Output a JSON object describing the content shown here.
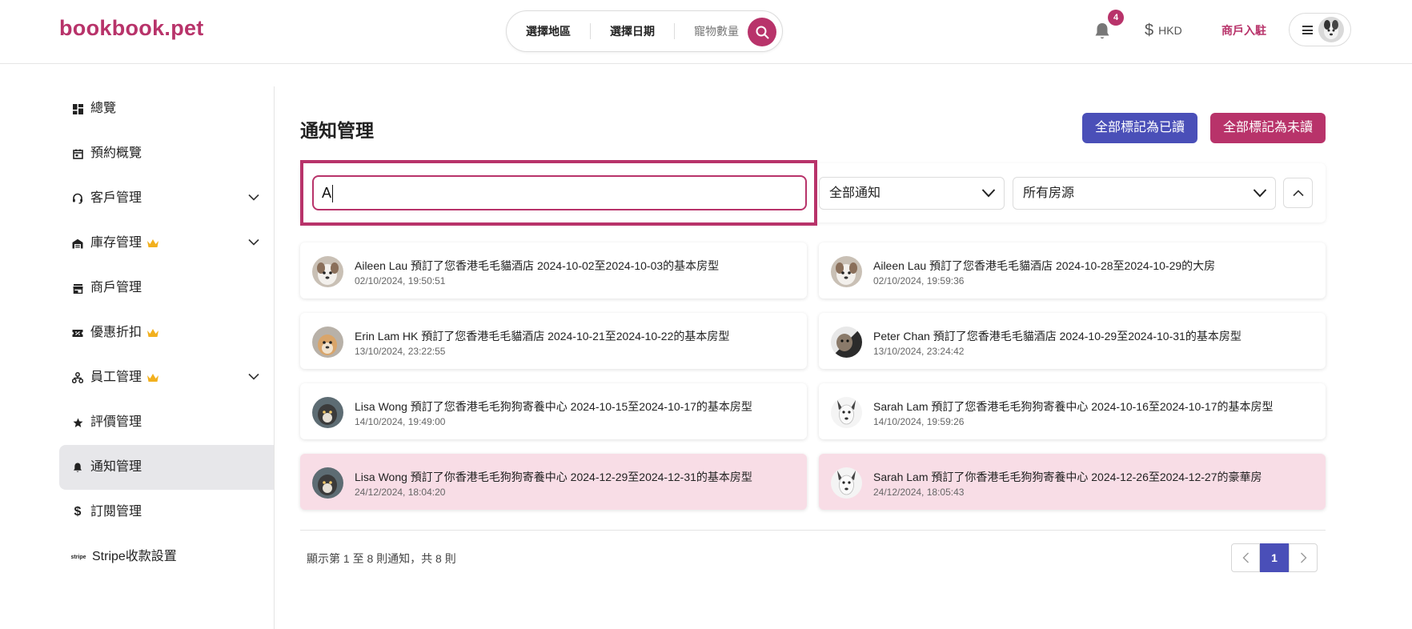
{
  "brand": {
    "logo_text": "bookbook.pet",
    "accent": "#b8336a",
    "secondary": "#4a4fb8"
  },
  "header": {
    "search": {
      "region": "選擇地區",
      "date": "選擇日期",
      "pets": "寵物數量"
    },
    "notification_count": "4",
    "currency": "HKD",
    "merchant_link": "商戶入駐"
  },
  "sidebar": {
    "items": [
      {
        "label": "總覽",
        "icon": "dashboard-icon"
      },
      {
        "label": "預約概覽",
        "icon": "calendar-icon"
      },
      {
        "label": "客戶管理",
        "icon": "headset-icon",
        "expandable": true
      },
      {
        "label": "庫存管理",
        "icon": "warehouse-icon",
        "premium": true,
        "expandable": true
      },
      {
        "label": "商戶管理",
        "icon": "store-icon"
      },
      {
        "label": "優惠折扣",
        "icon": "ticket-icon",
        "premium": true
      },
      {
        "label": "員工管理",
        "icon": "org-chart-icon",
        "premium": true,
        "expandable": true
      },
      {
        "label": "評價管理",
        "icon": "star-icon"
      },
      {
        "label": "通知管理",
        "icon": "bell-icon",
        "active": true
      },
      {
        "label": "訂閱管理",
        "icon": "dollar-icon"
      },
      {
        "label": "Stripe收款設置",
        "icon": "stripe-icon"
      }
    ]
  },
  "main": {
    "title": "通知管理",
    "mark_all_read": "全部標記為已讀",
    "mark_all_unread": "全部標記為未讀",
    "search_value": "A",
    "filter_type": "全部通知",
    "filter_property": "所有房源",
    "notifications": [
      {
        "message": "Aileen Lau 預訂了您香港毛毛貓酒店 2024-10-02至2024-10-03的基本房型",
        "time": "02/10/2024, 19:50:51",
        "unread": false
      },
      {
        "message": "Aileen Lau 預訂了您香港毛毛貓酒店 2024-10-28至2024-10-29的大房",
        "time": "02/10/2024, 19:59:36",
        "unread": false
      },
      {
        "message": "Erin Lam HK 預訂了您香港毛毛貓酒店 2024-10-21至2024-10-22的基本房型",
        "time": "13/10/2024, 23:22:55",
        "unread": false
      },
      {
        "message": "Peter Chan 預訂了您香港毛毛貓酒店 2024-10-29至2024-10-31的基本房型",
        "time": "13/10/2024, 23:24:42",
        "unread": false
      },
      {
        "message": "Lisa Wong 預訂了您香港毛毛狗狗寄養中心 2024-10-15至2024-10-17的基本房型",
        "time": "14/10/2024, 19:49:00",
        "unread": false
      },
      {
        "message": "Sarah Lam 預訂了您香港毛毛狗狗寄養中心 2024-10-16至2024-10-17的基本房型",
        "time": "14/10/2024, 19:59:26",
        "unread": false
      },
      {
        "message": "Lisa Wong 預訂了你香港毛毛狗狗寄養中心 2024-12-29至2024-12-31的基本房型",
        "time": "24/12/2024, 18:04:20",
        "unread": true
      },
      {
        "message": "Sarah Lam 預訂了你香港毛毛狗狗寄養中心 2024-12-26至2024-12-27的豪華房",
        "time": "24/12/2024, 18:05:43",
        "unread": true
      }
    ],
    "summary": "顯示第 1 至 8 則通知，共 8 則",
    "current_page": "1"
  }
}
